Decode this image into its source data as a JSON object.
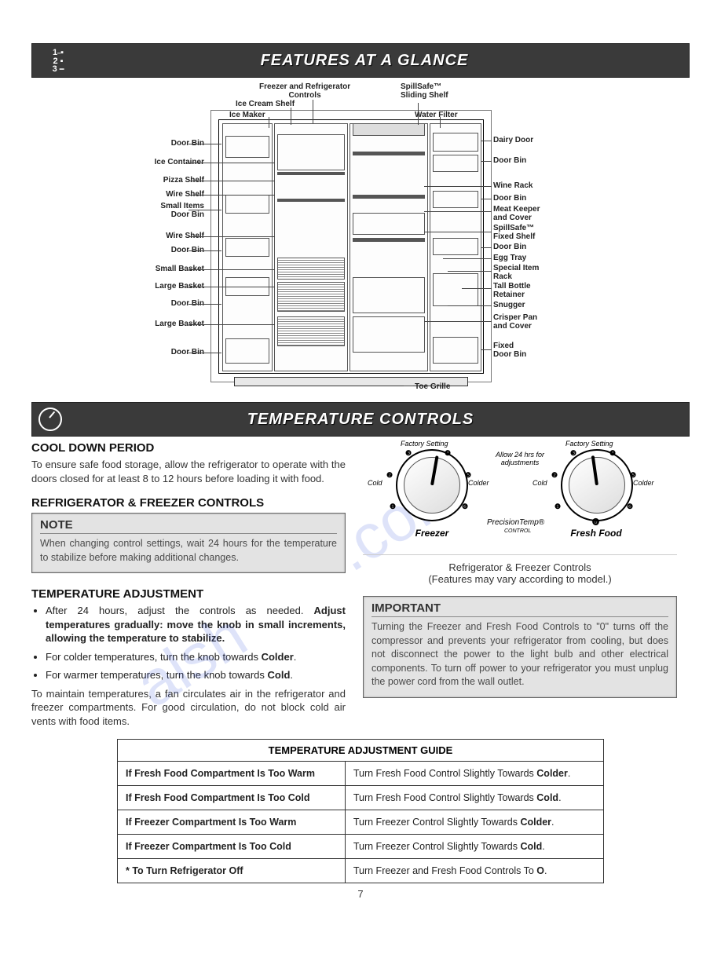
{
  "banner1": {
    "title": "FEATURES AT A GLANCE",
    "icon_numbers": "1\n2\n3"
  },
  "diagram": {
    "top_labels": {
      "freezer_refrig_controls": "Freezer and Refrigerator\nControls",
      "ice_cream_shelf": "Ice Cream Shelf",
      "ice_maker": "Ice Maker",
      "spillsafe_sliding": "SpillSafe™\nSliding Shelf",
      "water_filter": "Water Filter"
    },
    "left_labels": [
      "Door Bin",
      "Ice Container",
      "Pizza Shelf",
      "Wire Shelf",
      "Small Items\nDoor Bin",
      "Wire Shelf",
      "Door Bin",
      "Small Basket",
      "Large Basket",
      "Door Bin",
      "Large Basket",
      "Door Bin"
    ],
    "right_labels": [
      "Dairy Door",
      "Door Bin",
      "Wine Rack",
      "Door Bin",
      "Meat Keeper\nand Cover",
      "SpillSafe™\nFixed Shelf",
      "Door Bin",
      "Egg Tray",
      "Special Item\nRack",
      "Tall Bottle\nRetainer",
      "Snugger",
      "Crisper Pan\nand Cover",
      "Fixed\nDoor Bin"
    ],
    "toe_grille": "Toe Grille"
  },
  "banner2": {
    "title": "TEMPERATURE CONTROLS"
  },
  "leftcol": {
    "cool_down_heading": "COOL DOWN PERIOD",
    "cool_down_body": "To ensure safe food storage, allow the refrigerator to operate with the doors closed for at least 8 to 12 hours before loading it with food.",
    "controls_heading": "REFRIGERATOR & FREEZER CONTROLS",
    "note_title": "NOTE",
    "note_body": "When changing control settings, wait 24 hours for the temperature to stabilize before making additional changes.",
    "temp_adj_heading": "TEMPERATURE ADJUSTMENT",
    "bullet1_pre": "After 24 hours, adjust the controls as needed. ",
    "bullet1_bold": "Adjust temperatures gradually: move the knob in small increments, allowing the temperature to stabilize.",
    "bullet2_pre": "For colder temperatures, turn the knob towards ",
    "bullet2_bold": "Colder",
    "bullet3_pre": "For warmer temperatures, turn the knob towards ",
    "bullet3_bold": "Cold",
    "maintain_body": "To maintain temperatures, a fan circulates air in the refrigerator and freezer compartments. For good circulation, do not block cold air vents with food items."
  },
  "rightcol": {
    "factory_setting": "Factory Setting",
    "allow24": "Allow 24 hrs for\nadjustments",
    "cold": "Cold",
    "colder": "Colder",
    "freezer_lbl": "Freezer",
    "fresh_food_lbl": "Fresh Food",
    "precisiontemp": "PrecisionTemp®",
    "control_small": "CONTROL",
    "caption1": "Refrigerator & Freezer Controls",
    "caption2": "(Features may vary according to model.)",
    "important_title": "IMPORTANT",
    "important_body": "Turning the Freezer and Fresh Food Controls to \"0\" turns off the compressor and prevents your refrigerator from cooling, but does not disconnect the power to the light bulb and other electrical components. To turn off power to your refrigerator you must unplug the power cord from the wall outlet."
  },
  "table": {
    "header": "TEMPERATURE ADJUSTMENT GUIDE",
    "rows": [
      {
        "c1": "If Fresh Food Compartment Is Too Warm",
        "c2a": "Turn Fresh Food Control Slightly Towards ",
        "c2b": "Colder",
        "c2c": "."
      },
      {
        "c1": "If Fresh Food Compartment Is Too Cold",
        "c2a": "Turn Fresh Food Control Slightly Towards ",
        "c2b": "Cold",
        "c2c": "."
      },
      {
        "c1": "If Freezer Compartment Is Too Warm",
        "c2a": "Turn Freezer Control Slightly Towards ",
        "c2b": "Colder",
        "c2c": "."
      },
      {
        "c1": "If Freezer Compartment Is Too Cold",
        "c2a": "Turn Freezer Control Slightly Towards ",
        "c2b": "Cold",
        "c2c": "."
      },
      {
        "c1": "* To Turn Refrigerator Off",
        "c2a": "Turn Freezer and Fresh Food Controls To ",
        "c2b": "O",
        "c2c": "."
      }
    ]
  },
  "page_number": "7",
  "watermark_a": ".com",
  "watermark_b": "alsh"
}
